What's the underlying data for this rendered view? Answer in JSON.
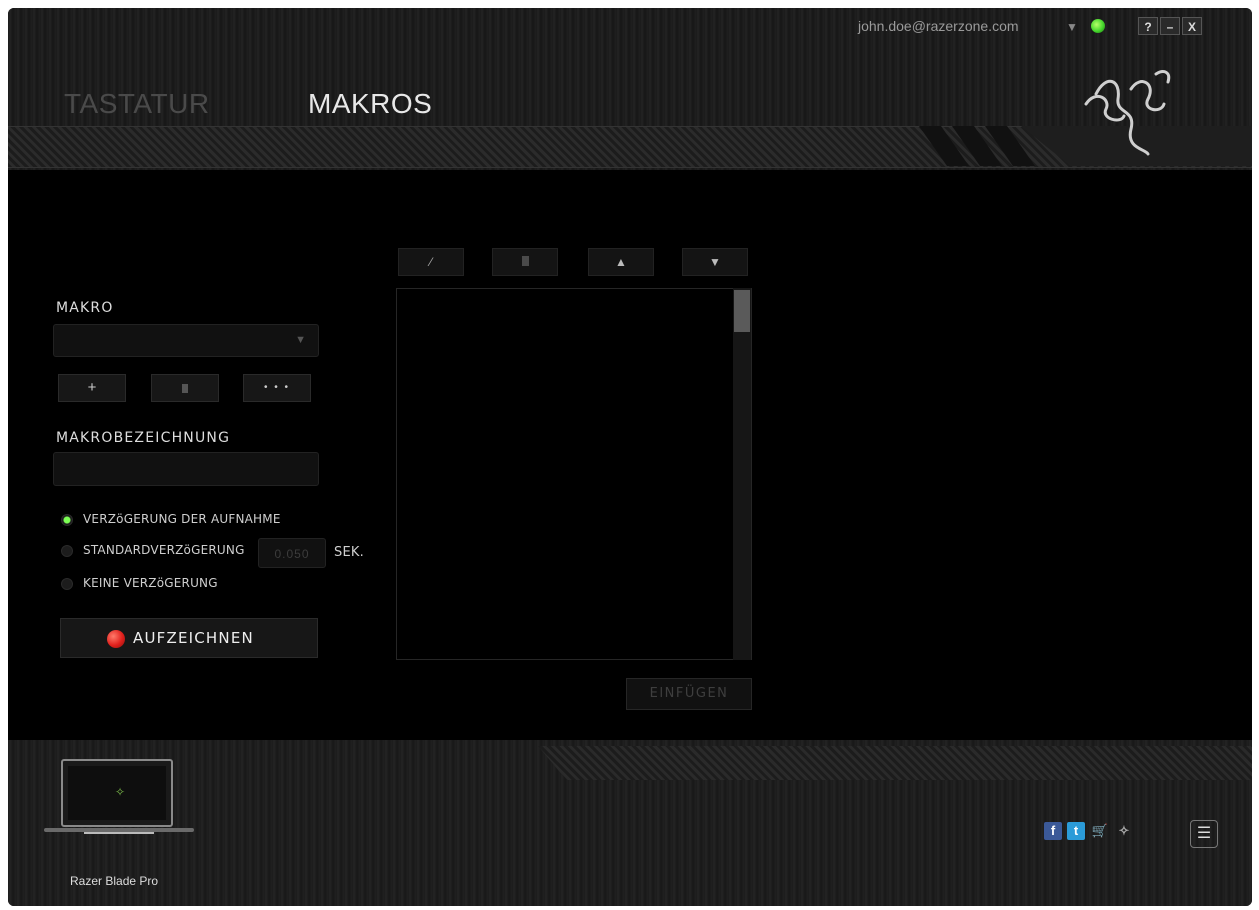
{
  "header": {
    "tabs": [
      {
        "label": "TASTATUR",
        "active": false
      },
      {
        "label": "MAKROS",
        "active": true
      }
    ],
    "account": "john.doe@razerzone.com",
    "window_buttons": [
      "?",
      "–",
      "X"
    ],
    "status_color": "#44d62c"
  },
  "macro_panel": {
    "macro_label": "MAKRO",
    "macro_select_value": "",
    "add_label": "+",
    "delete_icon": "trash-icon",
    "more_label": "• • •",
    "name_label": "MAKROBEZEICHNUNG",
    "name_value": "",
    "delay_options": [
      {
        "label": "VERZöGERUNG DER AUFNAHME",
        "selected": true
      },
      {
        "label": "STANDARDVERZöGERUNG",
        "selected": false
      },
      {
        "label": "KEINE VERZöGERUNG",
        "selected": false
      }
    ],
    "default_delay_value": "0.050",
    "delay_unit": "SEK.",
    "record_label": "AUFZEICHNEN",
    "record_color": "#e0201c"
  },
  "editor": {
    "toolbar_icons": [
      "pencil-icon",
      "trash-icon",
      "arrow-up-icon",
      "arrow-down-icon"
    ],
    "events": [],
    "insert_label": "EINFÜGEN"
  },
  "footer": {
    "device_name": "Razer Blade Pro",
    "social_icons": [
      "facebook-icon",
      "twitter-icon",
      "cart-icon",
      "razer-icon"
    ],
    "menu_icon": "menu-icon"
  }
}
